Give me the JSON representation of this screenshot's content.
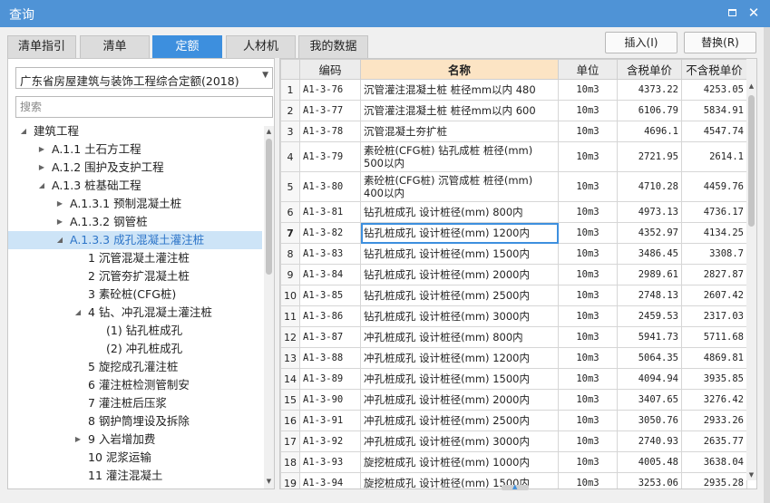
{
  "window": {
    "title": "查询"
  },
  "tabs": [
    {
      "label": "清单指引",
      "active": false
    },
    {
      "label": "清单",
      "active": false
    },
    {
      "label": "定额",
      "active": true
    },
    {
      "label": "人材机",
      "active": false
    },
    {
      "label": "我的数据",
      "active": false
    }
  ],
  "actions": {
    "insert": "插入(I)",
    "replace": "替换(R)"
  },
  "left": {
    "dropdown_value": "广东省房屋建筑与装饰工程综合定额(2018)",
    "search_placeholder": "搜索",
    "tree": [
      {
        "label": "建筑工程",
        "arrow": "down",
        "level": 0
      },
      {
        "label": "A.1.1 土石方工程",
        "arrow": "right",
        "level": 1
      },
      {
        "label": "A.1.2 围护及支护工程",
        "arrow": "right",
        "level": 1
      },
      {
        "label": "A.1.3 桩基础工程",
        "arrow": "down",
        "level": 1
      },
      {
        "label": "A.1.3.1 预制混凝土桩",
        "arrow": "right",
        "level": 2
      },
      {
        "label": "A.1.3.2 钢管桩",
        "arrow": "right",
        "level": 2
      },
      {
        "label": "A.1.3.3 成孔混凝土灌注桩",
        "arrow": "down",
        "level": 2,
        "selected": true
      },
      {
        "label": "1 沉管混凝土灌注桩",
        "arrow": "",
        "level": 3
      },
      {
        "label": "2 沉管夯扩混凝土桩",
        "arrow": "",
        "level": 3
      },
      {
        "label": "3 素砼桩(CFG桩)",
        "arrow": "",
        "level": 3
      },
      {
        "label": "4 钻、冲孔混凝土灌注桩",
        "arrow": "down",
        "level": 3
      },
      {
        "label": "(1) 钻孔桩成孔",
        "arrow": "",
        "level": 4
      },
      {
        "label": "(2) 冲孔桩成孔",
        "arrow": "",
        "level": 4
      },
      {
        "label": "5 旋挖成孔灌注桩",
        "arrow": "",
        "level": 3
      },
      {
        "label": "6 灌注桩检测管制安",
        "arrow": "",
        "level": 3
      },
      {
        "label": "7 灌注桩后压浆",
        "arrow": "",
        "level": 3
      },
      {
        "label": "8 钢护筒埋设及拆除",
        "arrow": "",
        "level": 3
      },
      {
        "label": "9 入岩增加费",
        "arrow": "right",
        "level": 3
      },
      {
        "label": "10 泥浆运输",
        "arrow": "",
        "level": 3
      },
      {
        "label": "11 灌注混凝土",
        "arrow": "",
        "level": 3
      }
    ]
  },
  "grid": {
    "headers": {
      "code": "编码",
      "name": "名称",
      "unit": "单位",
      "tax_price": "含税单价",
      "notax_price": "不含税单价"
    },
    "rows": [
      {
        "no": "1",
        "code": "A1-3-76",
        "name": "沉管灌注混凝土桩 桩径mm以内 480",
        "unit": "10m3",
        "tax": "4373.22",
        "notax": "4253.05"
      },
      {
        "no": "2",
        "code": "A1-3-77",
        "name": "沉管灌注混凝土桩 桩径mm以内 600",
        "unit": "10m3",
        "tax": "6106.79",
        "notax": "5834.91"
      },
      {
        "no": "3",
        "code": "A1-3-78",
        "name": "沉管混凝土夯扩桩",
        "unit": "10m3",
        "tax": "4696.1",
        "notax": "4547.74"
      },
      {
        "no": "4",
        "code": "A1-3-79",
        "name": "素砼桩(CFG桩) 钻孔成桩 桩径(mm) 500以内",
        "unit": "10m3",
        "tax": "2721.95",
        "notax": "2614.1"
      },
      {
        "no": "5",
        "code": "A1-3-80",
        "name": "素砼桩(CFG桩) 沉管成桩 桩径(mm) 400以内",
        "unit": "10m3",
        "tax": "4710.28",
        "notax": "4459.76"
      },
      {
        "no": "6",
        "code": "A1-3-81",
        "name": "钻孔桩成孔 设计桩径(mm) 800内",
        "unit": "10m3",
        "tax": "4973.13",
        "notax": "4736.17"
      },
      {
        "no": "7",
        "code": "A1-3-82",
        "name": "钻孔桩成孔 设计桩径(mm) 1200内",
        "unit": "10m3",
        "tax": "4352.97",
        "notax": "4134.25"
      },
      {
        "no": "8",
        "code": "A1-3-83",
        "name": "钻孔桩成孔 设计桩径(mm) 1500内",
        "unit": "10m3",
        "tax": "3486.45",
        "notax": "3308.7"
      },
      {
        "no": "9",
        "code": "A1-3-84",
        "name": "钻孔桩成孔 设计桩径(mm) 2000内",
        "unit": "10m3",
        "tax": "2989.61",
        "notax": "2827.87"
      },
      {
        "no": "10",
        "code": "A1-3-85",
        "name": "钻孔桩成孔 设计桩径(mm) 2500内",
        "unit": "10m3",
        "tax": "2748.13",
        "notax": "2607.42"
      },
      {
        "no": "11",
        "code": "A1-3-86",
        "name": "钻孔桩成孔 设计桩径(mm) 3000内",
        "unit": "10m3",
        "tax": "2459.53",
        "notax": "2317.03"
      },
      {
        "no": "12",
        "code": "A1-3-87",
        "name": "冲孔桩成孔 设计桩径(mm) 800内",
        "unit": "10m3",
        "tax": "5941.73",
        "notax": "5711.68"
      },
      {
        "no": "13",
        "code": "A1-3-88",
        "name": "冲孔桩成孔 设计桩径(mm) 1200内",
        "unit": "10m3",
        "tax": "5064.35",
        "notax": "4869.81"
      },
      {
        "no": "14",
        "code": "A1-3-89",
        "name": "冲孔桩成孔 设计桩径(mm) 1500内",
        "unit": "10m3",
        "tax": "4094.94",
        "notax": "3935.85"
      },
      {
        "no": "15",
        "code": "A1-3-90",
        "name": "冲孔桩成孔 设计桩径(mm) 2000内",
        "unit": "10m3",
        "tax": "3407.65",
        "notax": "3276.42"
      },
      {
        "no": "16",
        "code": "A1-3-91",
        "name": "冲孔桩成孔 设计桩径(mm) 2500内",
        "unit": "10m3",
        "tax": "3050.76",
        "notax": "2933.26"
      },
      {
        "no": "17",
        "code": "A1-3-92",
        "name": "冲孔桩成孔 设计桩径(mm) 3000内",
        "unit": "10m3",
        "tax": "2740.93",
        "notax": "2635.77"
      },
      {
        "no": "18",
        "code": "A1-3-93",
        "name": "旋挖桩成孔 设计桩径(mm) 1000内",
        "unit": "10m3",
        "tax": "4005.48",
        "notax": "3638.04"
      },
      {
        "no": "19",
        "code": "A1-3-94",
        "name": "旋挖桩成孔 设计桩径(mm) 1500内",
        "unit": "10m3",
        "tax": "3253.06",
        "notax": "2935.28"
      }
    ],
    "current_row": "7"
  },
  "colors": {
    "title_bar": "#4f93d6",
    "active_tab": "#3d8fde",
    "selection": "#cde4f7",
    "name_header": "#fce4c4"
  },
  "icons": {
    "maximize": "maximize-icon",
    "close": "close-icon"
  }
}
